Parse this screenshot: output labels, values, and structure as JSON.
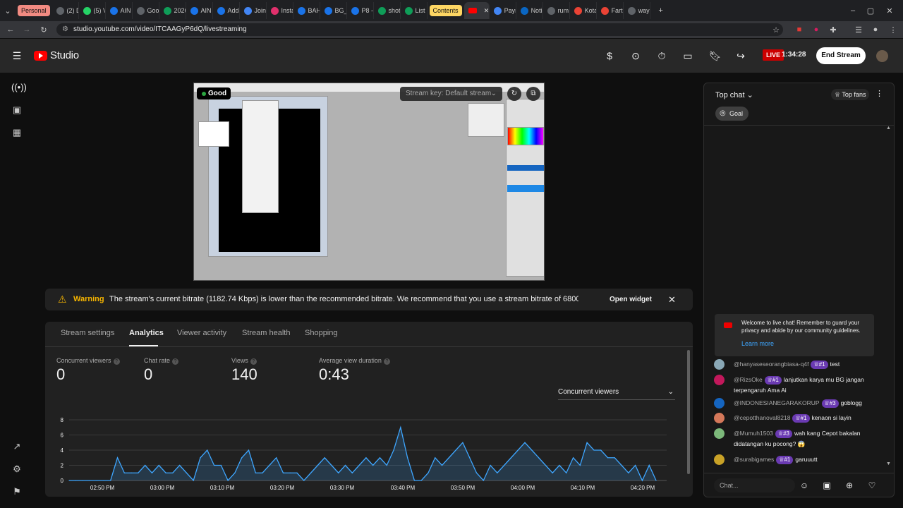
{
  "browser": {
    "tab_groups": [
      {
        "label": "Personal",
        "color": "#f28b82"
      },
      {
        "label": "Contents",
        "color": "#fdd663"
      }
    ],
    "tabs": [
      {
        "label": "(2) D",
        "color": "#5f6368"
      },
      {
        "label": "(5) V",
        "color": "#25d366"
      },
      {
        "label": "AIN",
        "color": "#1a73e8"
      },
      {
        "label": "Goo",
        "color": "#5f6368"
      },
      {
        "label": "2026",
        "color": "#0f9d58"
      },
      {
        "label": "AIN",
        "color": "#1a73e8"
      },
      {
        "label": "Add",
        "color": "#1a73e8"
      },
      {
        "label": "Join",
        "color": "#4285f4"
      },
      {
        "label": "Insta",
        "color": "#e1306c"
      },
      {
        "label": "BAH",
        "color": "#1a73e8"
      },
      {
        "label": "BG_",
        "color": "#1a73e8"
      },
      {
        "label": "P8 -",
        "color": "#1a73e8"
      },
      {
        "label": "shot",
        "color": "#0f9d58"
      },
      {
        "label": "List",
        "color": "#0f9d58"
      }
    ],
    "tabs_after": [
      {
        "label": "Payn",
        "color": "#4285f4"
      },
      {
        "label": "Noti",
        "color": "#0a66c2"
      },
      {
        "label": "rum",
        "color": "#5f6368"
      },
      {
        "label": "Kota",
        "color": "#ea4335"
      },
      {
        "label": "Fart",
        "color": "#ea4335"
      },
      {
        "label": "way",
        "color": "#5f6368"
      }
    ],
    "url": "studio.youtube.com/video/ITCAAGyP6dQ/livestreaming"
  },
  "header": {
    "logo": "Studio",
    "live_label": "LIVE",
    "live_time": "1:34:28",
    "end_stream": "End Stream"
  },
  "preview": {
    "health": "Good",
    "stream_key": "Stream key: Default stream",
    "refresh_icon": "refresh-icon",
    "popout_icon": "popout-icon"
  },
  "warning": {
    "title": "Warning",
    "text": "The stream's current bitrate (1182.74 Kbps) is lower than the recommended bitrate. We recommend that you use a stream bitrate of 6800 ...",
    "action": "Open widget"
  },
  "analytics": {
    "tabs": [
      "Stream settings",
      "Analytics",
      "Viewer activity",
      "Stream health",
      "Shopping"
    ],
    "selected_tab": "Analytics",
    "metrics": [
      {
        "label": "Concurrent viewers",
        "value": "0"
      },
      {
        "label": "Chat rate",
        "value": "0"
      },
      {
        "label": "Views",
        "value": "140"
      },
      {
        "label": "Average view duration",
        "value": "0:43"
      }
    ],
    "selector": "Concurrent viewers"
  },
  "chart_data": {
    "type": "area",
    "title": "",
    "xlabel": "",
    "ylabel": "",
    "ylim": [
      0,
      8
    ],
    "yticks": [
      "8",
      "6",
      "4",
      "2",
      "0"
    ],
    "xticks": [
      "02:50 PM",
      "03:00 PM",
      "03:10 PM",
      "03:20 PM",
      "03:30 PM",
      "03:40 PM",
      "03:50 PM",
      "04:00 PM",
      "04:10 PM",
      "04:20 PM"
    ],
    "values": [
      0,
      0,
      0,
      0,
      0,
      0,
      0,
      3,
      1,
      1,
      1,
      2,
      1,
      2,
      1,
      1,
      2,
      1,
      0,
      3,
      4,
      2,
      2,
      0,
      1,
      3,
      4,
      1,
      1,
      2,
      3,
      1,
      1,
      1,
      0,
      1,
      2,
      3,
      2,
      1,
      2,
      1,
      2,
      3,
      2,
      3,
      2,
      4,
      7,
      3,
      0,
      0,
      1,
      3,
      2,
      3,
      4,
      5,
      3,
      1,
      0,
      2,
      1,
      2,
      3,
      4,
      5,
      4,
      3,
      2,
      1,
      2,
      1,
      3,
      2,
      5,
      4,
      4,
      3,
      3,
      2,
      1,
      2,
      0,
      2,
      0
    ],
    "grid": true,
    "series_color": "#3ea6ff"
  },
  "chat": {
    "title": "Top chat",
    "top_fans": "Top fans",
    "goal": "Goal",
    "welcome": "Welcome to live chat! Remember to guard your privacy and abide by our community guidelines.",
    "learn_more": "Learn more",
    "messages": [
      {
        "name": "@hanyaseseorangbiasa-q4f",
        "badge": "#1",
        "text": "test",
        "color": "#8aa8b6"
      },
      {
        "name": "@RizsOke",
        "badge": "#1",
        "text": "lanjutkan karya mu BG jangan terpengaruh Ama Ai",
        "color": "#c2185b"
      },
      {
        "name": "@INDONESIANEGARAKORUP",
        "badge": "#3",
        "text": "goblogg",
        "color": "#1565c0"
      },
      {
        "name": "@cepotthanoval8218",
        "badge": "#1",
        "text": "kenaon si layin",
        "color": "#d4785a"
      },
      {
        "name": "@Mumuh1503",
        "badge": "#3",
        "text": "wah kang Cepot bakalan didatangan ku pocong? 😱",
        "color": "#7cb87a"
      },
      {
        "name": "@surabigames",
        "badge": "#1",
        "text": "garuuutt",
        "color": "#c9a227"
      }
    ],
    "input_placeholder": "Chat..."
  }
}
